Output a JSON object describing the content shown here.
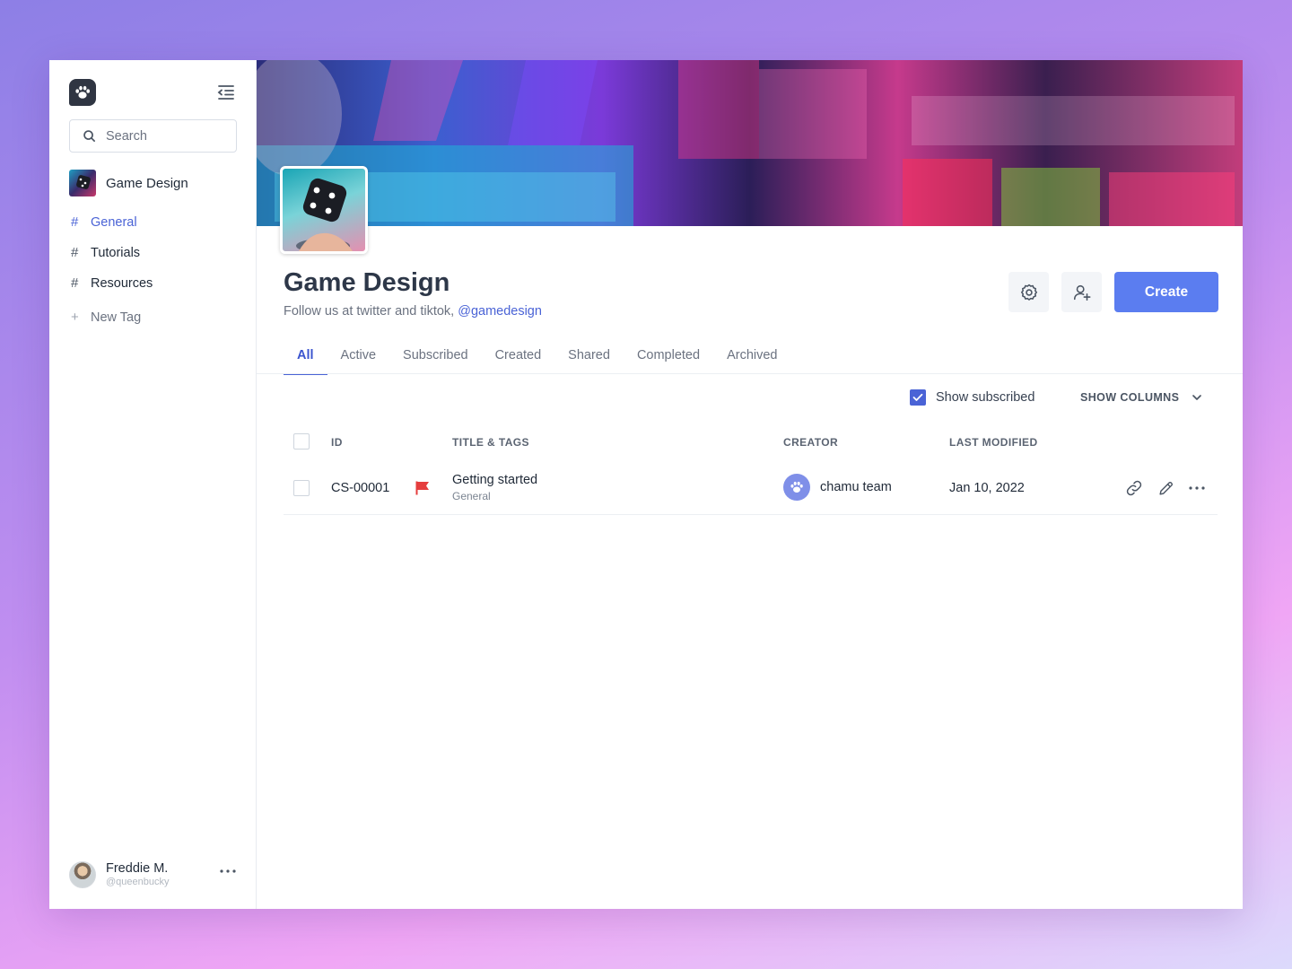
{
  "sidebar": {
    "search_placeholder": "Search",
    "workspace_name": "Game Design",
    "nav": [
      {
        "label": "General",
        "prefix": "#"
      },
      {
        "label": "Tutorials",
        "prefix": "#"
      },
      {
        "label": "Resources",
        "prefix": "#"
      }
    ],
    "new_tag": {
      "label": "New Tag",
      "prefix": "+"
    },
    "user": {
      "name": "Freddie M.",
      "handle": "@queenbucky"
    }
  },
  "group": {
    "title": "Game Design",
    "subtitle": "Follow us at twitter and tiktok,",
    "handle": "@gamedesign",
    "create_label": "Create"
  },
  "tabs": [
    "All",
    "Active",
    "Subscribed",
    "Created",
    "Shared",
    "Completed",
    "Archived"
  ],
  "filters": {
    "show_subscribed_label": "Show subscribed",
    "show_subscribed_checked": true,
    "show_columns_label": "SHOW COLUMNS"
  },
  "table": {
    "columns": [
      "ID",
      "TITLE & TAGS",
      "CREATOR",
      "LAST MODIFIED"
    ],
    "rows": [
      {
        "id": "CS-00001",
        "title": "Getting started",
        "tag": "General",
        "creator": "chamu team",
        "modified": "Jan 10, 2022"
      }
    ]
  },
  "colors": {
    "accent": "#4a63d6",
    "primary_button": "#5b7df0",
    "flag": "#e53e3e"
  },
  "icons": [
    "paw-logo-icon",
    "collapse-sidebar-icon",
    "search-icon",
    "gear-icon",
    "add-user-icon",
    "check-icon",
    "chevron-down-icon",
    "flag-icon",
    "link-icon",
    "pencil-icon",
    "more-horizontal-icon"
  ]
}
